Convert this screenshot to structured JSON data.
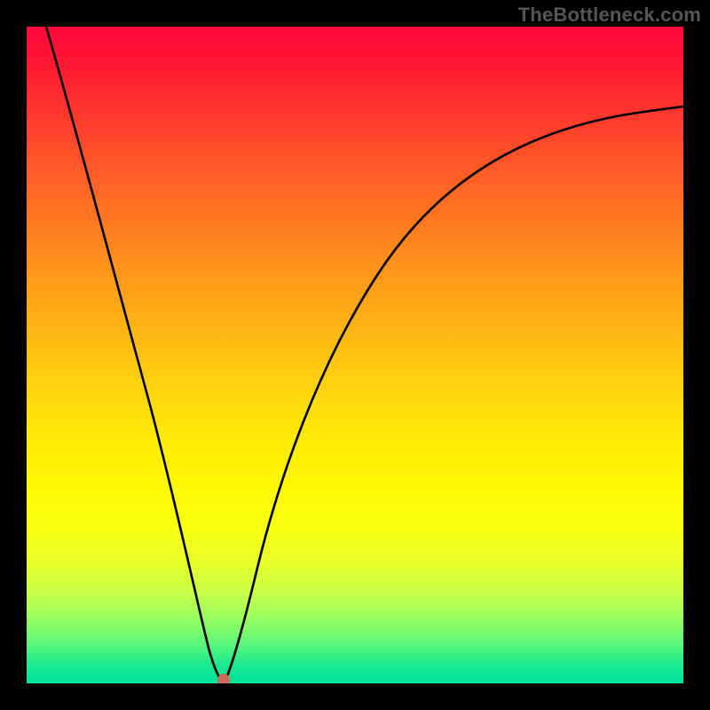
{
  "watermark": "TheBottleneck.com",
  "colors": {
    "top": "#ff073a",
    "midTop": "#ff981a",
    "mid": "#ffe808",
    "midBottom": "#c8ff45",
    "bottom": "#00e29d",
    "curve": "#000000",
    "marker": "#cc6b5a",
    "frame": "#000000"
  },
  "chart_data": {
    "type": "line",
    "title": "",
    "xlabel": "",
    "ylabel": "",
    "xlim": [
      0,
      100
    ],
    "ylim": [
      0,
      100
    ],
    "grid": false,
    "legend": false,
    "annotations": [
      {
        "type": "vertex-marker",
        "x": 28,
        "y": 0
      }
    ],
    "series": [
      {
        "name": "left-branch",
        "x": [
          3,
          6,
          10,
          14,
          18,
          22,
          25,
          27,
          28
        ],
        "values": [
          100,
          89,
          74,
          58,
          43,
          27,
          14,
          4,
          0
        ]
      },
      {
        "name": "right-branch",
        "x": [
          28,
          30,
          33,
          37,
          42,
          48,
          55,
          63,
          72,
          82,
          92,
          100
        ],
        "values": [
          0,
          12,
          28,
          43,
          55,
          65,
          72,
          78,
          82,
          85,
          87,
          88
        ]
      }
    ]
  }
}
